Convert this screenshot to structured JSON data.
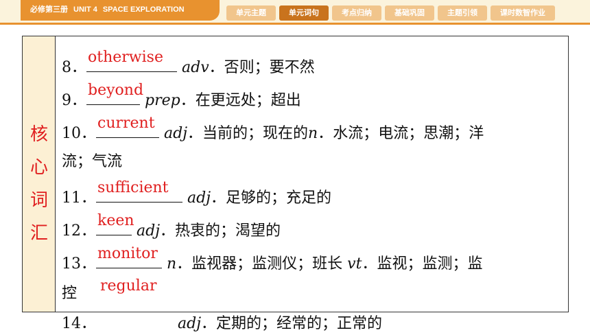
{
  "header": {
    "book": "必修第三册",
    "unit": "UNIT 4",
    "unit_title": "SPACE EXPLORATION",
    "tabs": [
      {
        "label": "单元主题",
        "active": false
      },
      {
        "label": "单元词句",
        "active": true
      },
      {
        "label": "考点归纳",
        "active": false
      },
      {
        "label": "基础巩固",
        "active": false
      },
      {
        "label": "主题引领",
        "active": false
      },
      {
        "label": "课时数智作业",
        "active": false
      }
    ],
    "accent": "#e8922f"
  },
  "sidebar": {
    "chars": [
      "核",
      "心",
      "词",
      "汇"
    ],
    "color": "#e02020"
  },
  "entries": [
    {
      "num": "8．",
      "answer": "otherwise",
      "pos": "adv",
      "def": "．否则；要不然"
    },
    {
      "num": "9．",
      "answer": "beyond",
      "pos": "prep",
      "def": "．在更远处；超出"
    },
    {
      "num": "10．",
      "answer": "current",
      "pos": "adj",
      "def": "．当前的；现在的",
      "pos2": "n",
      "def2": "．水流；电流；思潮；洋"
    },
    {
      "cont": "流；气流"
    },
    {
      "num": "11．",
      "answer": "sufficient",
      "pos": "adj",
      "def": "．足够的；充足的"
    },
    {
      "num": "12．",
      "answer": "keen",
      "pos": "adj",
      "def": "．热衷的；渴望的"
    },
    {
      "num": "13．",
      "answer": "monitor",
      "pos": "n",
      "def": "．监视器；监测仪；班长 ",
      "pos2": "vt",
      "def2": "．监视；监测；监"
    },
    {
      "cont": "控"
    },
    {
      "num": "14．",
      "answer": "regular",
      "pos": "adj",
      "def": "．定期的；经常的；正常的"
    }
  ]
}
